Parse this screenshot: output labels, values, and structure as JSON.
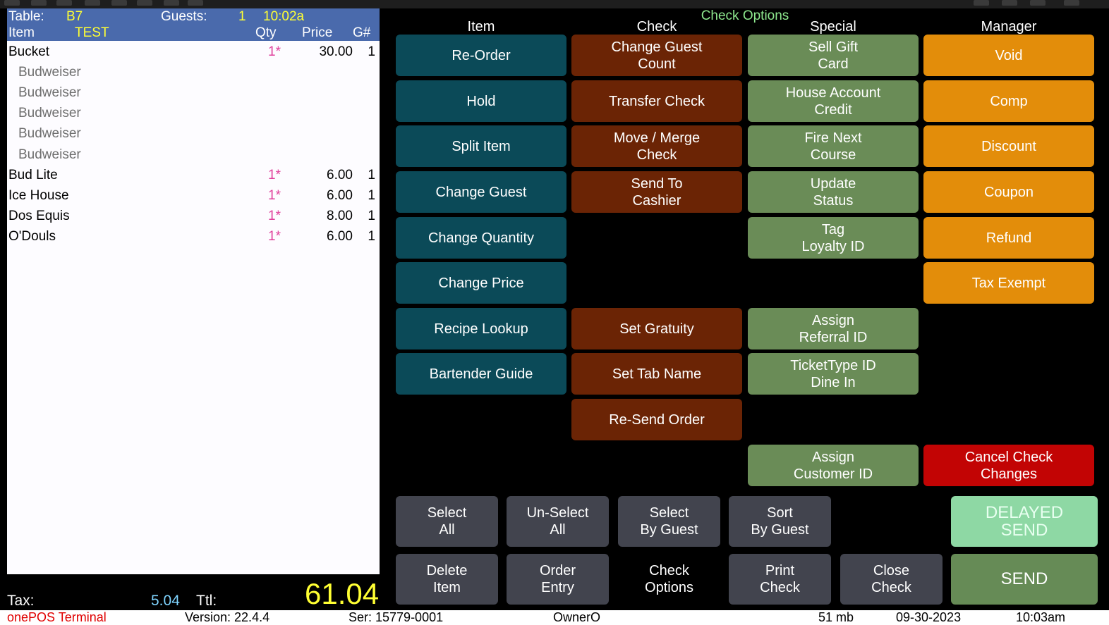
{
  "check": {
    "table_label": "Table:",
    "table_value": "B7",
    "guests_label": "Guests:",
    "guests_value": "1",
    "time": "10:02a",
    "item_label": "Item",
    "item_name": "TEST",
    "col_qty": "Qty",
    "col_price": "Price",
    "col_guest": "G#",
    "items": [
      {
        "name": "Bucket",
        "qty": "1*",
        "price": "30.00",
        "guest": "1",
        "sub": false
      },
      {
        "name": "Budweiser",
        "qty": "",
        "price": "",
        "guest": "",
        "sub": true
      },
      {
        "name": "Budweiser",
        "qty": "",
        "price": "",
        "guest": "",
        "sub": true
      },
      {
        "name": "Budweiser",
        "qty": "",
        "price": "",
        "guest": "",
        "sub": true
      },
      {
        "name": "Budweiser",
        "qty": "",
        "price": "",
        "guest": "",
        "sub": true
      },
      {
        "name": "Budweiser",
        "qty": "",
        "price": "",
        "guest": "",
        "sub": true
      },
      {
        "name": "Bud Lite",
        "qty": "1*",
        "price": "6.00",
        "guest": "1",
        "sub": false
      },
      {
        "name": "Ice House",
        "qty": "1*",
        "price": "6.00",
        "guest": "1",
        "sub": false
      },
      {
        "name": "Dos Equis",
        "qty": "1*",
        "price": "8.00",
        "guest": "1",
        "sub": false
      },
      {
        "name": "O'Douls",
        "qty": "1*",
        "price": "6.00",
        "guest": "1",
        "sub": false
      }
    ],
    "tax_label": "Tax:",
    "tax_value": "5.04",
    "total_label": "Ttl:",
    "total_value": "61.04"
  },
  "options": {
    "title": "Check Options",
    "columns": {
      "item": "Item",
      "check": "Check",
      "special": "Special",
      "manager": "Manager"
    },
    "item_buttons": [
      "Re-Order",
      "Hold",
      "Split Item",
      "Change Guest",
      "Change Quantity",
      "Change Price",
      "Recipe Lookup",
      "Bartender Guide"
    ],
    "check_buttons": [
      "Change Guest\nCount",
      "Transfer Check",
      "Move / Merge\nCheck",
      "Send To\nCashier",
      "Set Gratuity",
      "Set Tab Name",
      "Re-Send Order"
    ],
    "special_buttons": [
      "Sell Gift\nCard",
      "House Account\nCredit",
      "Fire Next\nCourse",
      "Update\nStatus",
      "Tag\nLoyalty ID",
      "Assign\nReferral ID",
      "TicketType ID\nDine In",
      "Assign\nCustomer ID"
    ],
    "manager_buttons": [
      "Void",
      "Comp",
      "Discount",
      "Coupon",
      "Refund",
      "Tax Exempt"
    ],
    "cancel_button": "Cancel Check\nChanges"
  },
  "bottom": {
    "select_all": "Select\nAll",
    "unselect_all": "Un-Select\nAll",
    "select_by_guest": "Select\nBy Guest",
    "sort_by_guest": "Sort\nBy Guest",
    "delete_item": "Delete\nItem",
    "order_entry": "Order\nEntry",
    "check_options": "Check\nOptions",
    "print_check": "Print\nCheck",
    "close_check": "Close\nCheck",
    "delayed_send": "DELAYED\nSEND",
    "send": "SEND"
  },
  "status": {
    "app_name": "onePOS Terminal",
    "version": "Version: 22.4.4",
    "serial": "Ser: 15779-0001",
    "user": "OwnerO",
    "memory": "51 mb",
    "date": "09-30-2023",
    "time": "10:03am"
  },
  "colors": {
    "header_bg": "#4a6aac",
    "item_btn": "#0b4a58",
    "check_btn": "#6b2405",
    "special_btn": "#6a8c57",
    "manager_btn": "#e38d0a",
    "cancel_btn": "#c20404",
    "gray_btn": "#42444e",
    "delayed_send_btn": "#8ed8a4",
    "send_btn": "#668b56",
    "total_color": "#ffff33",
    "tax_color": "#7fd4ff",
    "app_name_color": "#e00000"
  }
}
